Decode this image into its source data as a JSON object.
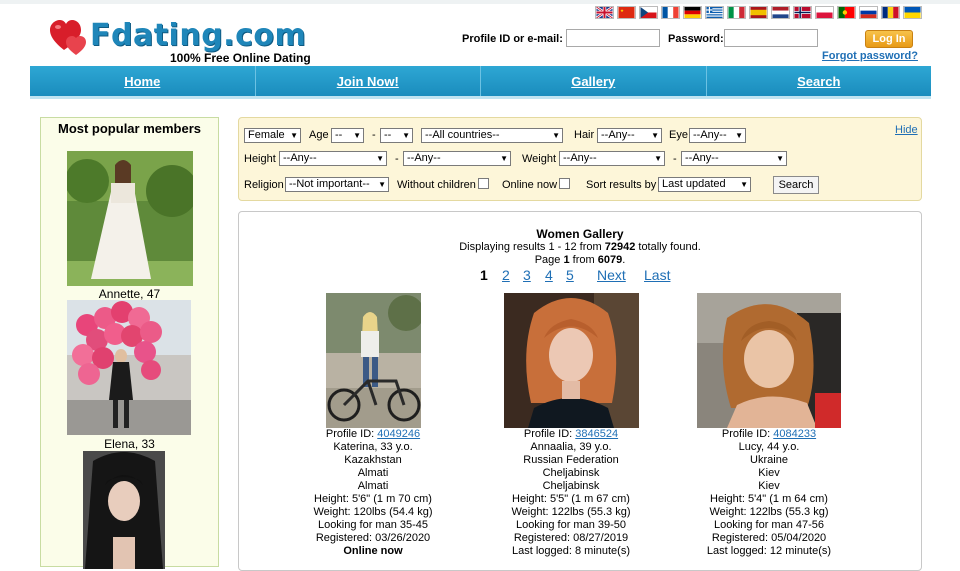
{
  "brand": {
    "name": "Fdating.com",
    "tagline": "100% Free Online Dating"
  },
  "languages": [
    "English",
    "Chinese",
    "Czech",
    "French",
    "German",
    "Greek",
    "Italian",
    "Spanish",
    "Dutch",
    "Norwegian",
    "Polish",
    "Portuguese",
    "Russian",
    "Romanian",
    "Ukrainian"
  ],
  "login": {
    "id_label": "Profile ID or e-mail:",
    "password_label": "Password:",
    "button": "Log In",
    "forgot": "Forgot password?"
  },
  "nav": [
    "Home",
    "Join Now!",
    "Gallery",
    "Search"
  ],
  "popular": {
    "title": "Most popular members",
    "members": [
      {
        "name": "Annette, 47"
      },
      {
        "name": "Elena, 33"
      },
      {
        "name": ""
      }
    ]
  },
  "search": {
    "gender": "Female",
    "age_label": "Age",
    "age_from": "--",
    "dash": "-",
    "age_to": "--",
    "country": "--All countries--",
    "hair_label": "Hair",
    "hair": "--Any--",
    "eye_label": "Eye",
    "eye": "--Any--",
    "hide": "Hide",
    "height_label": "Height",
    "height_from": "--Any--",
    "height_to": "--Any--",
    "weight_label": "Weight",
    "weight_from": "--Any--",
    "weight_to": "--Any--",
    "religion_label": "Religion",
    "religion": "--Not important--",
    "without_children": "Without children",
    "online_now": "Online now",
    "sort_label": "Sort results by",
    "sort": "Last updated",
    "button": "Search"
  },
  "gallery": {
    "title": "Women Gallery",
    "results_prefix": "Displaying results 1 - 12 from ",
    "results_total": "72942",
    "results_suffix": " totally found.",
    "page_prefix": "Page ",
    "page_current": "1",
    "page_middle": " from ",
    "page_total": "6079",
    "page_suffix": ".",
    "pages": [
      "1",
      "2",
      "3",
      "4",
      "5"
    ],
    "next": "Next",
    "last": "Last"
  },
  "profiles": [
    {
      "id_label": "Profile ID:",
      "id": "4049246",
      "name_age": "Katerina, 33 y.o.",
      "country": "Kazakhstan",
      "region": "Almati",
      "city": "Almati",
      "height": "Height: 5'6\" (1 m 70 cm)",
      "weight": "Weight: 120lbs (54.4 kg)",
      "looking": "Looking for man 35-45",
      "registered": "Registered: 03/26/2020",
      "status": "Online now"
    },
    {
      "id_label": "Profile ID:",
      "id": "3846524",
      "name_age": "Annaalia, 39 y.o.",
      "country": "Russian Federation",
      "region": "Cheljabinsk",
      "city": "Cheljabinsk",
      "height": "Height: 5'5\" (1 m 67 cm)",
      "weight": "Weight: 122lbs (55.3 kg)",
      "looking": "Looking for man 39-50",
      "registered": "Registered: 08/27/2019",
      "status": "Last logged: 8 minute(s)"
    },
    {
      "id_label": "Profile ID:",
      "id": "4084233",
      "name_age": "Lucy, 44 y.o.",
      "country": "Ukraine",
      "region": "Kiev",
      "city": "Kiev",
      "height": "Height: 5'4\" (1 m 64 cm)",
      "weight": "Weight: 122lbs (55.3 kg)",
      "looking": "Looking for man 47-56",
      "registered": "Registered: 05/04/2020",
      "status": "Last logged: 12 minute(s)"
    }
  ]
}
